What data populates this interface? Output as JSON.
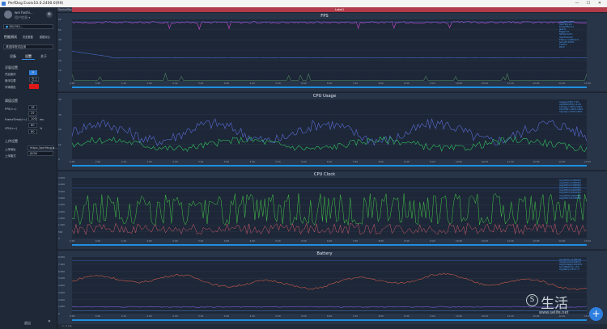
{
  "window": {
    "title": "PerfDog Evolv10.0.2400.0(R9)",
    "minimize": "—",
    "maximize": "☐",
    "close": "✕"
  },
  "sidebar": {
    "user_name": "wei hoshi...",
    "user_sub": "用户信息 ▾",
    "device": "SM-F90...",
    "tab_perf": "性能测试",
    "tab_history": "历史数据",
    "tab_compare": "数据对比",
    "app": "请选择测试应用",
    "subtabs": [
      "设备",
      "设置",
      "关于"
    ],
    "section1": "浮窗设置",
    "opt1_label": "开启悬浮",
    "opt1_value": "开",
    "opt2_label": "悬浮位置",
    "opt2_value": "左上 ▾",
    "opt3_label": "字体颜色",
    "section2": "阈值设置",
    "fps_label": "FPS(>=)",
    "fps_value": "18",
    "fps_value2": "25",
    "ft_label": "FrameTime(>=)",
    "ft_value": "100",
    "ft_unit": "ms",
    "cpu_label": "CPU(>=)",
    "cpu_value": "80",
    "cpu_value2": "80",
    "cpu_unit": "%",
    "section3": "上传设置",
    "upload_label": "上传地址",
    "upload_value": "https://perfdog.q...",
    "upload_fmt_label": "上传格式",
    "upload_fmt_value": "JSON",
    "footer_btn": "退出",
    "collapse": "«"
  },
  "tabs": {
    "left": "DeviceTab",
    "active": "Label1"
  },
  "panels": [
    {
      "title": "FPS",
      "legend": [
        "Avg(FPS):58.4",
        "Var(FPS):0.3",
        "Drop(FPS):0.1",
        "Jank:0",
        "BigJank:0",
        "Stutter:0.0%",
        "InterFrame:0",
        "FTime>=100ms:0",
        "Smooth:100%",
        "TSLM:0",
        "Dtt:0"
      ],
      "yticks": [
        "60",
        "50",
        "40",
        "30",
        "20",
        "10",
        "0"
      ]
    },
    {
      "title": "CPU Usage",
      "legend": [
        "AvgApp(CPU):7.9%",
        "AvgTotal(CPU):14.6%",
        "CpuApp<=80%:100%",
        "CpuTotal<=80%:100%",
        "CpuApp<=50%:100%"
      ],
      "yticks": [
        "40",
        "30",
        "20",
        "10",
        "0"
      ]
    },
    {
      "title": "CPU Clock",
      "legend": [
        "Avg(CPU0):1285MHz",
        "Avg(CPU1):1285MHz",
        "Avg(CPU2):1285MHz",
        "Avg(CPU3):1285MHz",
        "Avg(CPU4):1801MHz",
        "Avg(CPU5):1801MHz",
        "Avg(CPU6):1801MHz",
        "Avg(CPU7):2179MHz"
      ],
      "yticks": [
        "4,500",
        "4,000",
        "3,500",
        "3,000",
        "2,500",
        "2,000",
        "1,500",
        "1,000",
        "500",
        "0"
      ]
    },
    {
      "title": "Battery",
      "legend": [
        "Avg(Power):4156mW",
        "Avg(Current):942mA",
        "Avg(Voltage):4413mV",
        "Sum(Battery):1.3%",
        "Avg(Tempr):30.1°C"
      ],
      "yticks": [
        "8,000",
        "7,000",
        "6,000",
        "5,000",
        "4,000",
        "3,000",
        "2,000",
        "1,000",
        "0"
      ]
    }
  ],
  "xticks": [
    "0:00",
    "0:40",
    "1:20",
    "2:00",
    "2:40",
    "3:20",
    "4:00",
    "4:40",
    "5:20",
    "6:00",
    "6:40",
    "7:20",
    "8:00",
    "8:40",
    "9:20",
    "10:00",
    "10:40",
    "11:20",
    "12:00",
    "12:40",
    "13:20"
  ],
  "bottom_label": "1 / 1 log",
  "fab_icon": "+",
  "watermark": {
    "circle": "S",
    "main": "生活",
    "url": "www.selife.net"
  },
  "colors": {
    "fps": "#d04ad8",
    "cpu_app": "#32c060",
    "cpu_total": "#5b6cd8",
    "clock_big": "#46c84a",
    "clock_small": "#d05a6a",
    "power": "#c85a4a",
    "accent": "#1e8fe0"
  }
}
